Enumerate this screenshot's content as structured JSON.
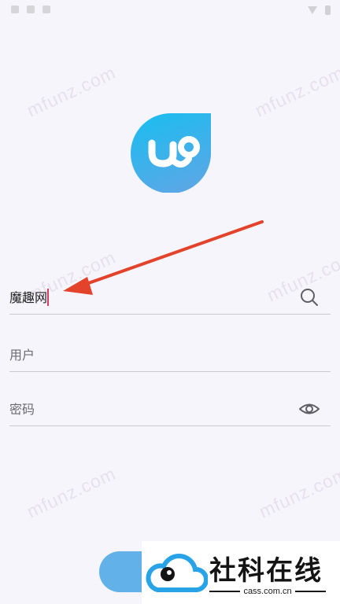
{
  "watermark": {
    "text": "mfunz.com"
  },
  "login": {
    "search": {
      "value": "魔趣网",
      "icon": "search-icon"
    },
    "username": {
      "placeholder": "用户"
    },
    "password": {
      "placeholder": "密码",
      "icon": "eye-icon"
    }
  },
  "brand": {
    "name": "社科在线",
    "domain": "cass.com.cn"
  },
  "colors": {
    "logo_gradient_top": "#1cbcef",
    "logo_gradient_bottom": "#5aa8e6",
    "annotation_arrow": "#e2432a",
    "caret": "#e0395d",
    "button": "#62b1e9",
    "background": "#f7f5fc"
  }
}
